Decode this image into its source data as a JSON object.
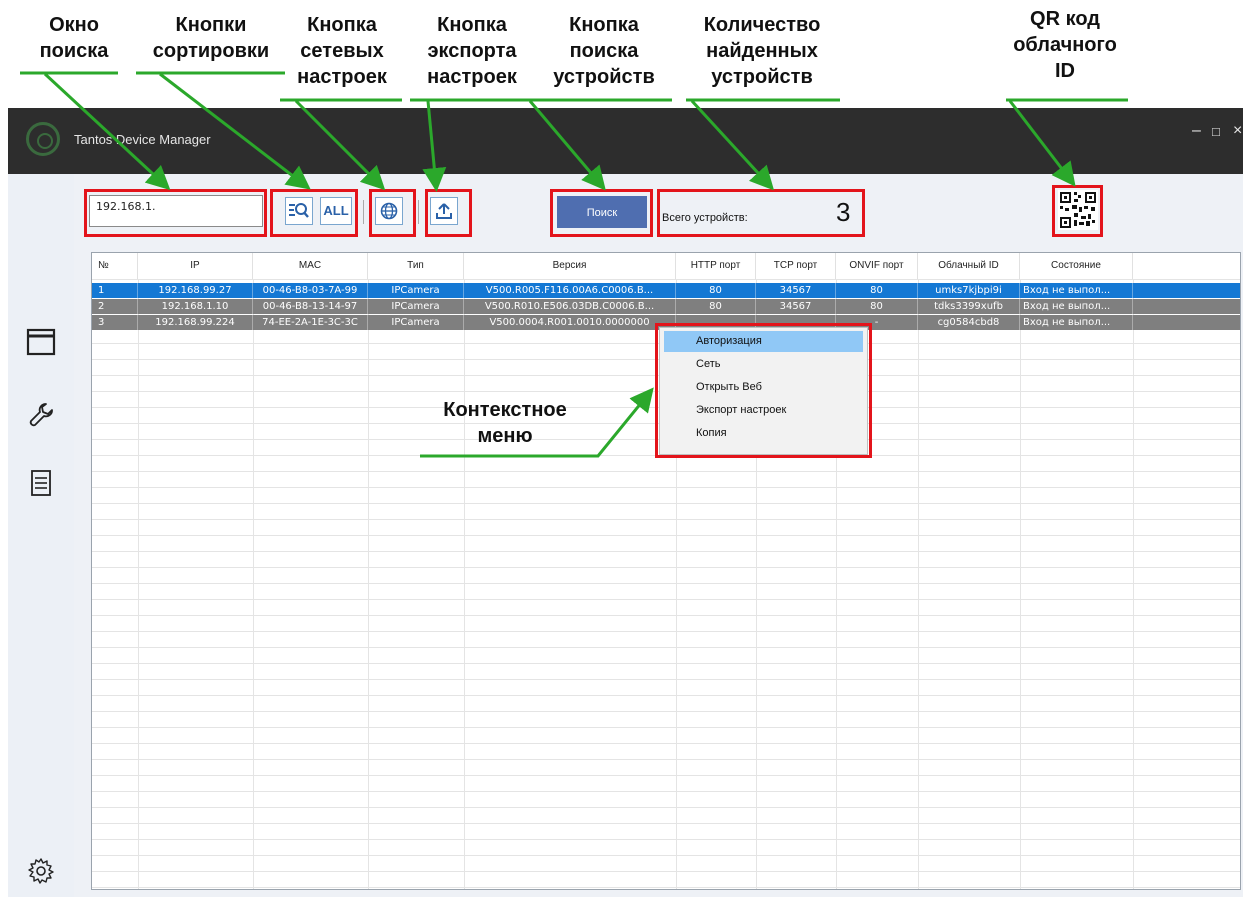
{
  "annotations": {
    "search_window": "Окно поиска",
    "sort_buttons": "Кнопки сортировки",
    "network_button": "Кнопка сетевых настроек",
    "export_button": "Кнопка экспорта настроек",
    "search_button": "Кнопка поиска устройств",
    "count": "Количество найденных устройств",
    "qr": "QR код облачного ID",
    "context_menu": "Контекстное меню"
  },
  "window": {
    "title": "Tantos Device Manager",
    "minimize": "–",
    "maximize": "□",
    "close": "×"
  },
  "toolbar": {
    "search_value": "192.168.1.",
    "sort_ip_icon": "sort-search-icon",
    "sort_all_label": "ALL",
    "search_button_label": "Поиск",
    "total_label": "Всего устройств:",
    "total_count": "3"
  },
  "table": {
    "columns": [
      "№",
      "IP",
      "MAC",
      "Тип",
      "Версия",
      "HTTP порт",
      "TCP порт",
      "ONVIF порт",
      "Облачный ID",
      "Состояние"
    ],
    "rows": [
      [
        "1",
        "192.168.99.27",
        "00-46-B8-03-7A-99",
        "IPCamera",
        "V500.R005.F116.00A6.C0006.B...",
        "80",
        "34567",
        "80",
        "umks7kjbpi9i",
        "Вход не выпол..."
      ],
      [
        "2",
        "192.168.1.10",
        "00-46-B8-13-14-97",
        "IPCamera",
        "V500.R010.E506.03DB.C0006.B...",
        "80",
        "34567",
        "80",
        "tdks3399xufb",
        "Вход не выпол..."
      ],
      [
        "3",
        "192.168.99.224",
        "74-EE-2A-1E-3C-3C",
        "IPCamera",
        "V500.0004.R001.0010.0000000",
        "",
        "",
        "-",
        "cg0584cbd8",
        "Вход не выпол..."
      ]
    ]
  },
  "context_menu": {
    "items": [
      "Авторизация",
      "Сеть",
      "Открыть Веб",
      "Экспорт настроек",
      "Копия"
    ]
  },
  "colors": {
    "selected_row": "#1478d4",
    "gray_row": "#7f7f7f",
    "annotation_box": "#e3141b",
    "annotation_arrow": "#2ba82b"
  }
}
